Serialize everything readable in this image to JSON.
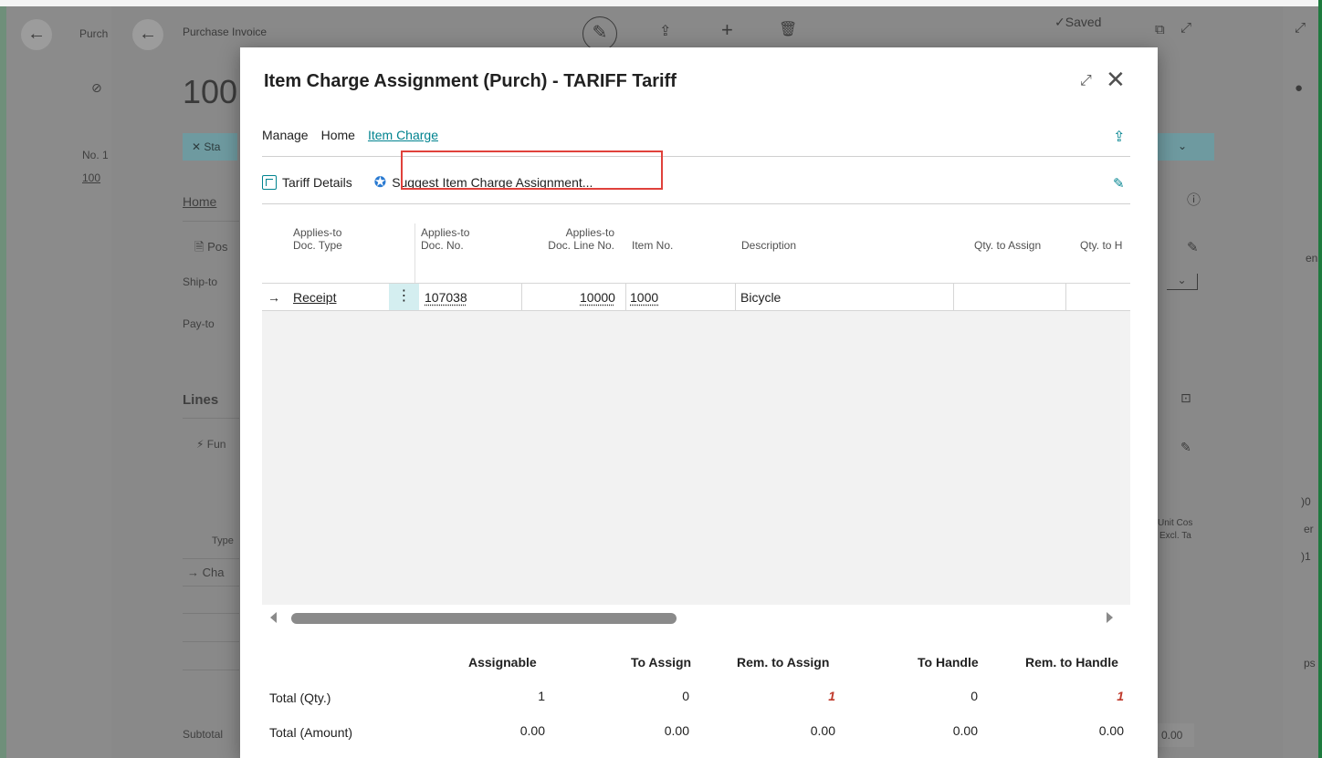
{
  "background": {
    "outer_breadcrumb": "Purch",
    "page_title": "Purchase Invoice",
    "doc_no_partial": "100",
    "no_label": "No. 1",
    "no_value": "100",
    "status_partial": "Sta",
    "home_tab": "Home",
    "post_partial": "Pos",
    "ship_to": "Ship-to",
    "pay_to": "Pay-to",
    "lines_heading": "Lines",
    "functions_partial": "Fun",
    "type_col": "Type",
    "row_type_partial": "Cha",
    "subtotal": "Subtotal",
    "saved_status": "✓Saved",
    "unit_cost": "Unit Cos",
    "excl_tax": "Excl. Ta",
    "subtotal_value": "0.00",
    "right_partial_en": "en",
    "right_partial_00": ")0",
    "right_partial_er": "er",
    "right_partial_01": ")1",
    "right_partial_ps": "ps"
  },
  "dialog": {
    "title": "Item Charge Assignment (Purch) - TARIFF Tariff",
    "menu": [
      "Manage",
      "Home",
      "Item Charge"
    ],
    "actions": {
      "tariff_details": "Tariff Details",
      "suggest": "Suggest Item Charge Assignment..."
    },
    "grid": {
      "headers": {
        "doc_type": [
          "Applies-to",
          "Doc. Type"
        ],
        "doc_no": [
          "Applies-to",
          "Doc. No."
        ],
        "doc_line_no": [
          "Applies-to",
          "Doc. Line No."
        ],
        "item_no": "Item No.",
        "description": "Description",
        "qty_to_assign": "Qty. to Assign",
        "qty_to_handle": "Qty. to H"
      },
      "rows": [
        {
          "arrow": "→",
          "doc_type": "Receipt",
          "doc_no": "107038",
          "doc_line_no": "10000",
          "item_no": "1000",
          "description": "Bicycle"
        }
      ]
    },
    "totals": {
      "headers": [
        "Assignable",
        "To Assign",
        "Rem. to Assign",
        "To Handle",
        "Rem. to Handle"
      ],
      "qty_label": "Total (Qty.)",
      "qty_values": [
        "1",
        "0",
        "1",
        "0",
        "1"
      ],
      "amount_label": "Total (Amount)",
      "amount_values": [
        "0.00",
        "0.00",
        "0.00",
        "0.00",
        "0.00"
      ]
    }
  },
  "colors": {
    "accent": "#00838f",
    "highlight_box": "#e0413b",
    "remaining_red": "#c0392b"
  }
}
